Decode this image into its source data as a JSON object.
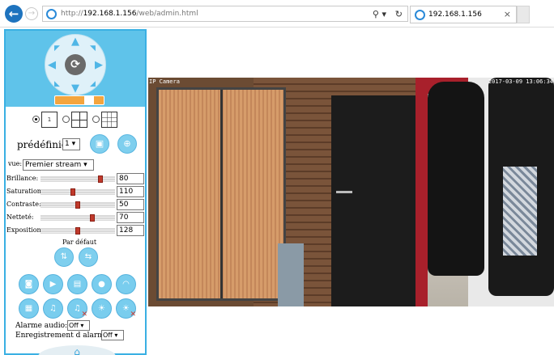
{
  "browser": {
    "url_prefix": "http://",
    "url_host": "192.168.1.156",
    "url_path": "/web/admin.html",
    "tab_title": "192.168.1.156",
    "tab_close": "×",
    "back_glyph": "←",
    "forward_glyph": "→",
    "search_glyph": "⚲ ▾",
    "refresh_glyph": "↻"
  },
  "ptz": {
    "up": "▲",
    "down": "▼",
    "left": "◀",
    "right": "▶",
    "up_left": "◤",
    "up_right": "◥",
    "down_left": "◣",
    "down_right": "◢",
    "center": "⟳",
    "speed_fraction": 0.8
  },
  "layout": {
    "options": [
      {
        "label": "1",
        "selected": true
      },
      {
        "label": "",
        "selected": false
      },
      {
        "label": "",
        "selected": false
      }
    ]
  },
  "preset": {
    "label": "prédéfinie:",
    "value": "1",
    "save_icon": "save-icon",
    "goto_icon": "target-icon"
  },
  "stream": {
    "label": "vue:",
    "value": "Premier stream"
  },
  "adjustments": [
    {
      "label": "Brillance:",
      "value": "80",
      "fraction": 0.8
    },
    {
      "label": "Saturation:",
      "value": "110",
      "fraction": 0.43
    },
    {
      "label": "Contraste:",
      "value": "50",
      "fraction": 0.5
    },
    {
      "label": "Netteté:",
      "value": "70",
      "fraction": 0.7
    },
    {
      "label": "Exposition:",
      "value": "128",
      "fraction": 0.5
    }
  ],
  "default_label": "Par défaut",
  "alarm": {
    "audio_label": "Alarme audio:",
    "audio_value": "Off",
    "record_label": "Enregistrement d alarme:",
    "record_value": "Off"
  },
  "camera": {
    "label": "IP Camera",
    "timestamp": "2017-03-09 13:06:34"
  },
  "colors": {
    "sidebar_border": "#3ab0e3",
    "ptz_background": "#5fc3ea",
    "button_blue": "#79cdee",
    "speed_orange": "#f3a53f",
    "slider_knob": "#c0392b"
  }
}
